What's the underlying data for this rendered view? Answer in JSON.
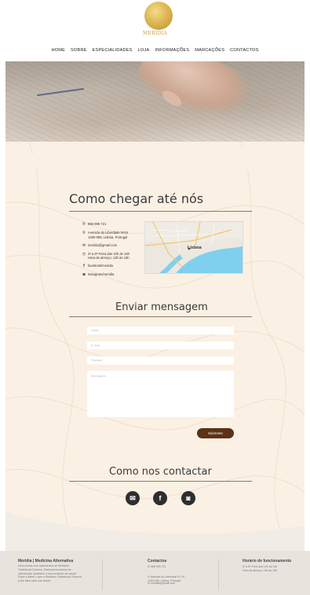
{
  "header": {
    "logo_text": "MERIDIA",
    "nav": [
      "HOME",
      "SOBRE",
      "ESPECIALIDADES",
      "LOJA",
      "INFORMAÇÕES",
      "MARCAÇÕES",
      "CONTACTOS"
    ]
  },
  "location": {
    "title": "Como chegar até nós",
    "items": [
      {
        "icon": "phone-icon",
        "glyph": "✆",
        "text": "966 999 721"
      },
      {
        "icon": "location-pin-icon",
        "glyph": "⚲",
        "text": "Avenida da Liberdade Nº24\n1250-096, Lisboa, Portugal"
      },
      {
        "icon": "mail-icon",
        "glyph": "✉",
        "text": "meridia@gmail.com"
      },
      {
        "icon": "clock-icon",
        "glyph": "◷",
        "text": "2ª a 6ª Feira das 10h às 19h\nHora de almoço: 13h às 15h"
      },
      {
        "icon": "facebook-icon",
        "glyph": "f",
        "text": "facebook/meridia"
      },
      {
        "icon": "instagram-icon",
        "glyph": "◙",
        "text": "instagram/meridia"
      }
    ],
    "map_label": "Lisboa"
  },
  "form": {
    "title": "Enviar mensagem",
    "name_placeholder": "Nome",
    "email_placeholder": "E-mail",
    "phone_placeholder": "Telefone",
    "message_placeholder": "Mensagem",
    "submit_label": "Submeter"
  },
  "social": {
    "title": "Como nos contactar"
  },
  "footer": {
    "about_title": "Meridia | Medicina Alternativa",
    "about_text": "Uma clínica com tratamentos de Medicina Tradicional Chinesa. Elaboramos planos de intervenção ajustados à sua condição de saúde. Fique a saber o que a Medicina Tradicional Chinesa pode fazer pela sua saúde.",
    "contacts_title": "Contactos",
    "contacts_phone": "966 999 721",
    "contacts_address": "Avenida da Liberdade Nº 24\n1250-096, Lisboa, Portugal",
    "contacts_email": "meridia@gmail.com",
    "hours_title": "Horário de funcionamento",
    "hours_text": "2ª a 6ª Feira das 10h às 19h\nHora de almoço: 13h às 15h"
  },
  "colors": {
    "accent": "#5b3216",
    "gold": "#c9a24b",
    "panel": "#fbf0e4",
    "footer": "#e8e4dd"
  }
}
